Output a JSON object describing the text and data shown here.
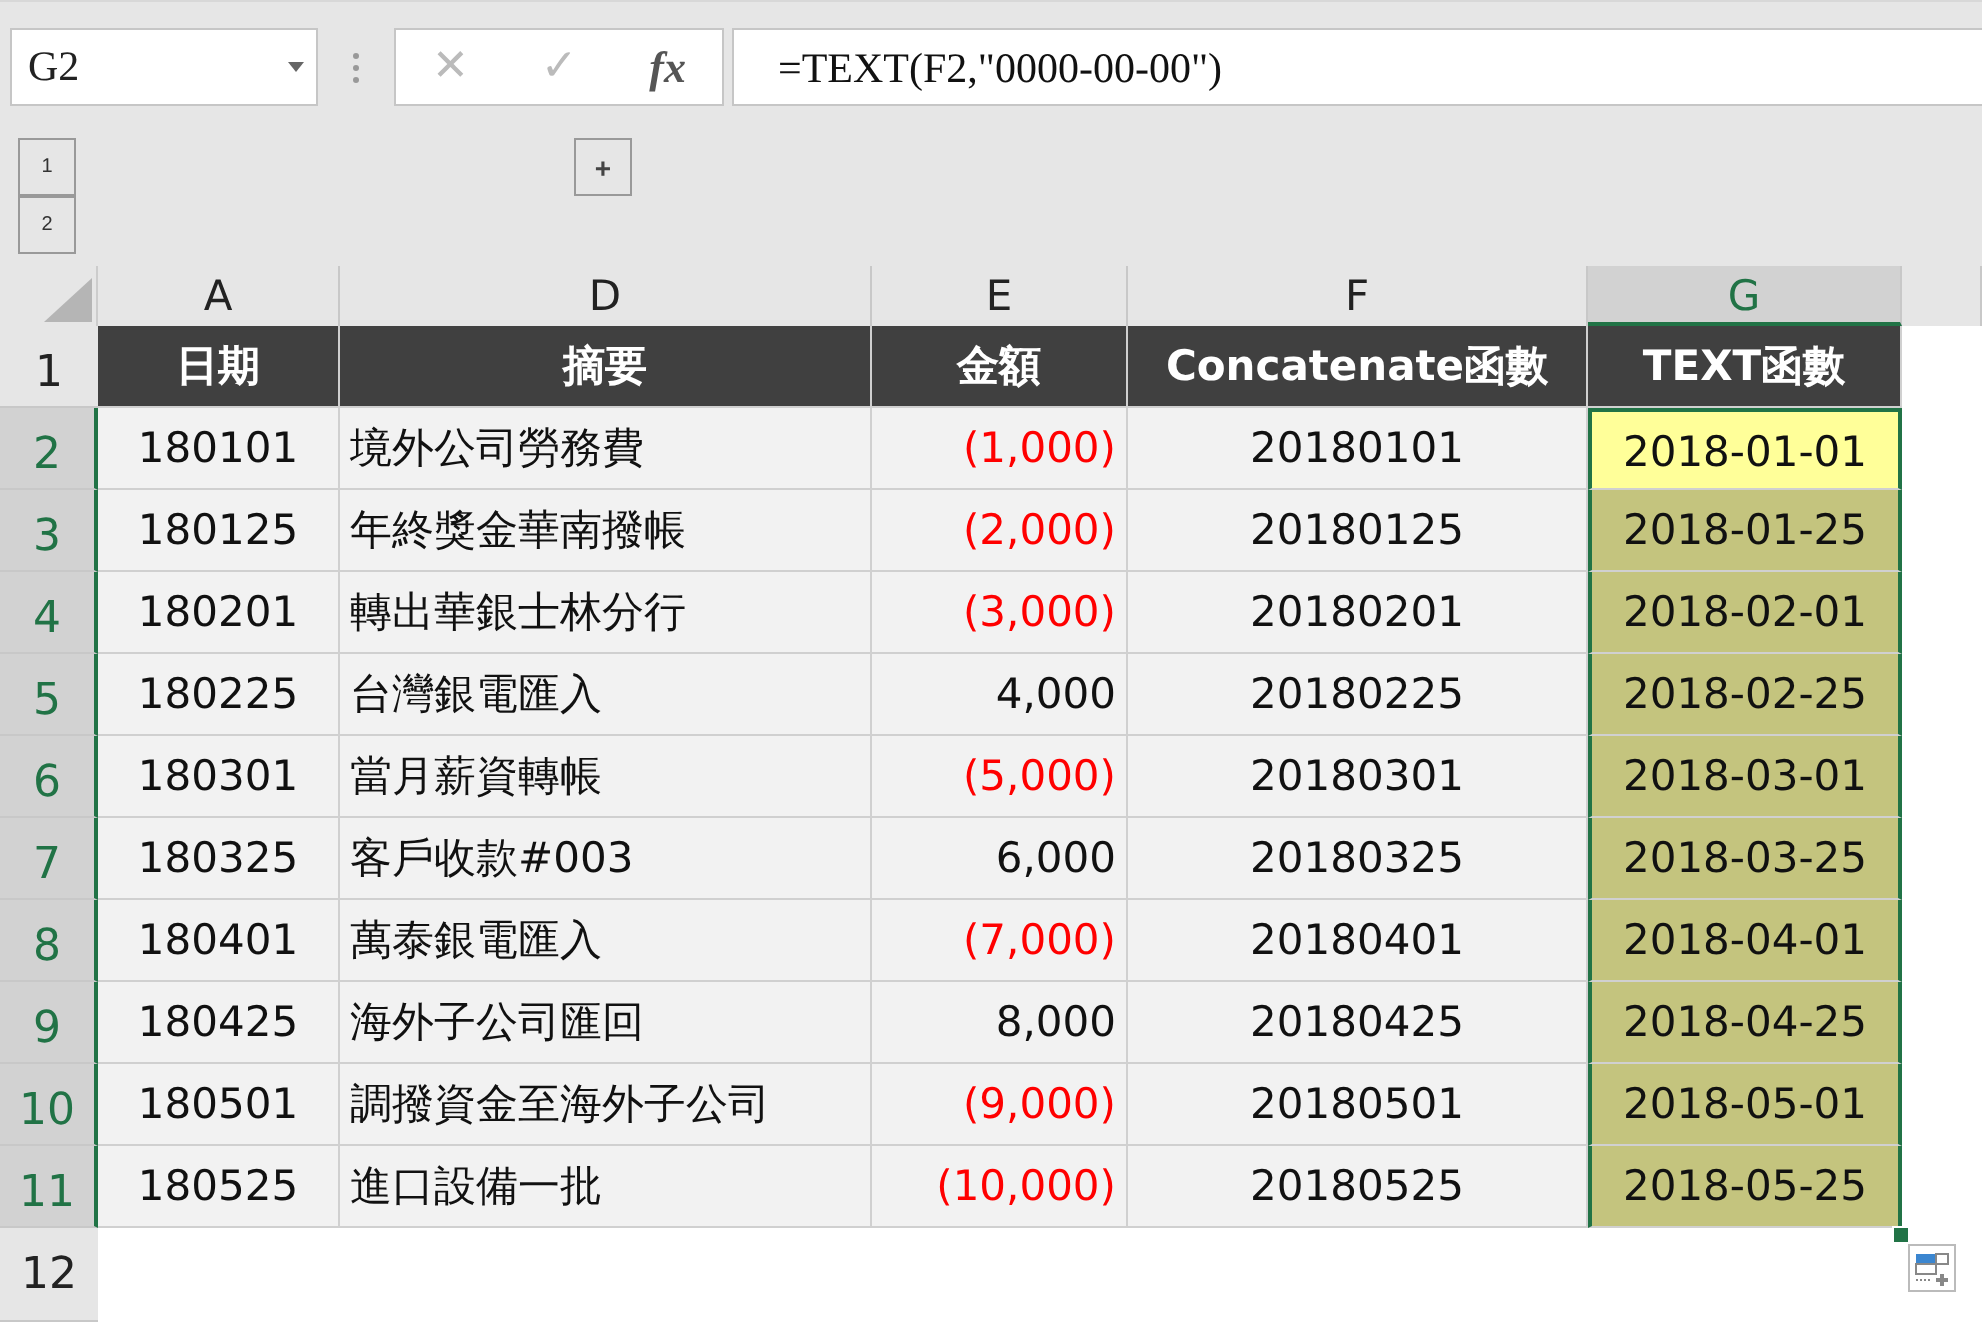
{
  "name_box": {
    "value": "G2"
  },
  "formula_bar": {
    "cancel": "✕",
    "enter": "✓",
    "function": "fx",
    "value": "=TEXT(F2,\"0000-00-00\")"
  },
  "outline": {
    "levels": [
      "1",
      "2"
    ],
    "expand": "+"
  },
  "columns": [
    {
      "label": "A",
      "selected": false
    },
    {
      "label": "D",
      "selected": false
    },
    {
      "label": "E",
      "selected": false
    },
    {
      "label": "F",
      "selected": false
    },
    {
      "label": "G",
      "selected": true
    }
  ],
  "header_row": {
    "number": "1",
    "selected": false,
    "cells": [
      "日期",
      "摘要",
      "金額",
      "Concatenate函數",
      "TEXT函數"
    ]
  },
  "rows": [
    {
      "number": "2",
      "selected": true,
      "date": "180101",
      "summary": "境外公司勞務費",
      "amount": "(1,000)",
      "negative": true,
      "concat": "20180101",
      "text": "2018-01-01",
      "active": true
    },
    {
      "number": "3",
      "selected": true,
      "date": "180125",
      "summary": "年終獎金華南撥帳",
      "amount": "(2,000)",
      "negative": true,
      "concat": "20180125",
      "text": "2018-01-25",
      "active": false
    },
    {
      "number": "4",
      "selected": true,
      "date": "180201",
      "summary": "轉出華銀士林分行",
      "amount": "(3,000)",
      "negative": true,
      "concat": "20180201",
      "text": "2018-02-01",
      "active": false
    },
    {
      "number": "5",
      "selected": true,
      "date": "180225",
      "summary": "台灣銀電匯入",
      "amount": "4,000",
      "negative": false,
      "concat": "20180225",
      "text": "2018-02-25",
      "active": false
    },
    {
      "number": "6",
      "selected": true,
      "date": "180301",
      "summary": "當月薪資轉帳",
      "amount": "(5,000)",
      "negative": true,
      "concat": "20180301",
      "text": "2018-03-01",
      "active": false
    },
    {
      "number": "7",
      "selected": true,
      "date": "180325",
      "summary": "客戶收款#003",
      "amount": "6,000",
      "negative": false,
      "concat": "20180325",
      "text": "2018-03-25",
      "active": false
    },
    {
      "number": "8",
      "selected": true,
      "date": "180401",
      "summary": "萬泰銀電匯入",
      "amount": "(7,000)",
      "negative": true,
      "concat": "20180401",
      "text": "2018-04-01",
      "active": false
    },
    {
      "number": "9",
      "selected": true,
      "date": "180425",
      "summary": "海外子公司匯回",
      "amount": "8,000",
      "negative": false,
      "concat": "20180425",
      "text": "2018-04-25",
      "active": false
    },
    {
      "number": "10",
      "selected": true,
      "date": "180501",
      "summary": "調撥資金至海外子公司",
      "amount": "(9,000)",
      "negative": true,
      "concat": "20180501",
      "text": "2018-05-01",
      "active": false
    },
    {
      "number": "11",
      "selected": true,
      "date": "180525",
      "summary": "進口設備一批",
      "amount": "(10,000)",
      "negative": true,
      "concat": "20180525",
      "text": "2018-05-25",
      "active": false
    }
  ],
  "empty_row": {
    "number": "12",
    "selected": false
  }
}
